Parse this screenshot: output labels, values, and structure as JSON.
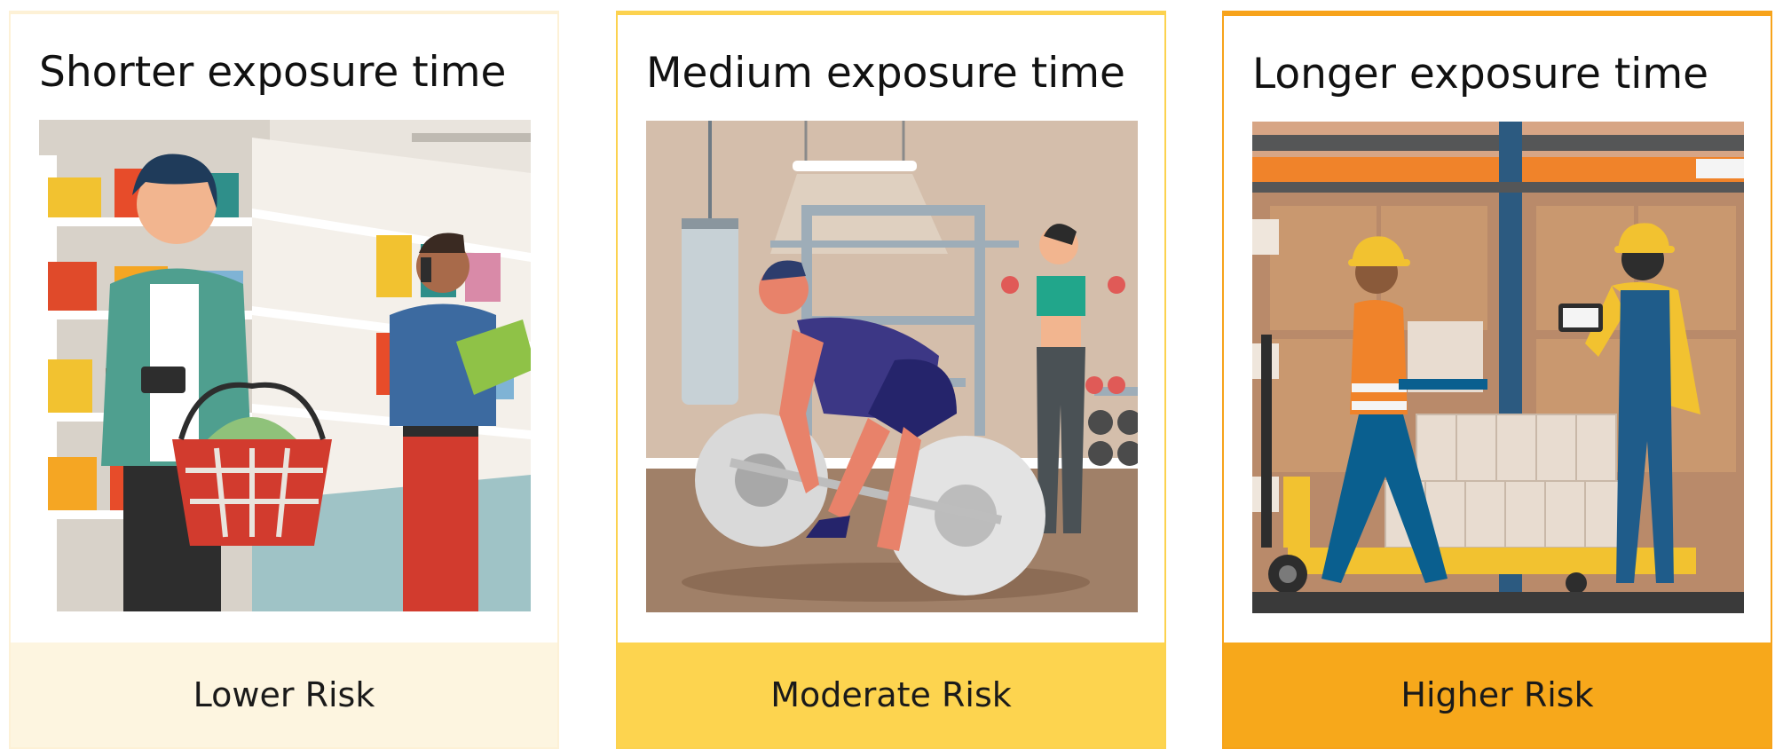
{
  "cards": [
    {
      "title": "Shorter exposure time",
      "risk_label": "Lower Risk",
      "scene": "grocery-store",
      "accent": "#fdf5e0"
    },
    {
      "title": "Medium exposure time",
      "risk_label": "Moderate Risk",
      "scene": "gym",
      "accent": "#fdd44f"
    },
    {
      "title": "Longer exposure time",
      "risk_label": "Higher Risk",
      "scene": "warehouse",
      "accent": "#f7a81b"
    }
  ]
}
